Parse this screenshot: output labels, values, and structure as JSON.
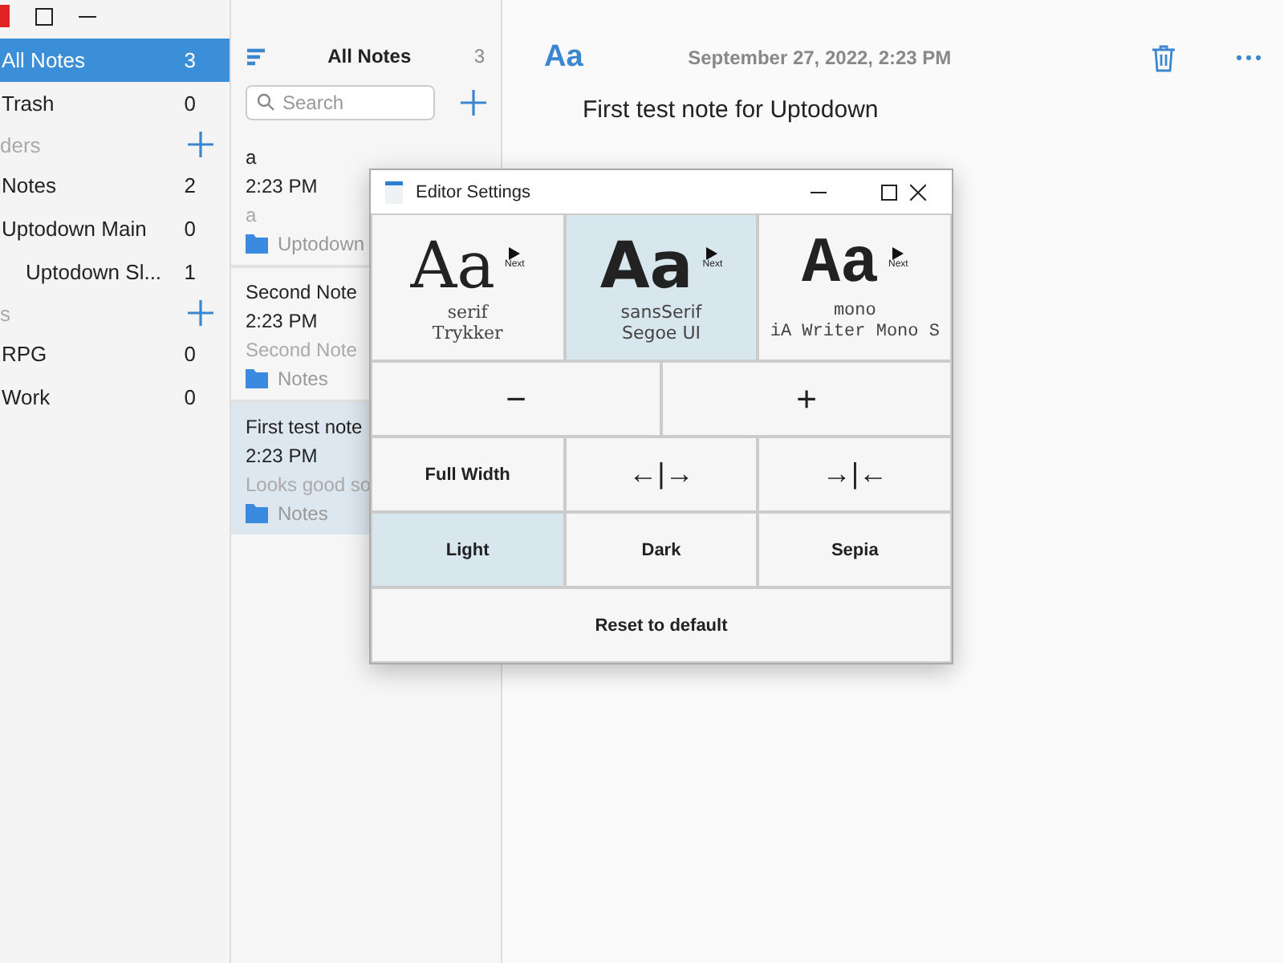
{
  "sidebar": {
    "items": [
      {
        "label": "All Notes",
        "count": "3",
        "selected": true
      },
      {
        "label": "Trash",
        "count": "0",
        "selected": false
      }
    ],
    "sections": [
      {
        "title": "ders",
        "items": [
          {
            "label": "Notes",
            "count": "2",
            "selected": false
          },
          {
            "label": "Uptodown Main",
            "count": "0",
            "selected": false,
            "children": [
              {
                "label": "Uptodown Sl...",
                "count": "1",
                "selected": false
              }
            ]
          }
        ]
      },
      {
        "title": "s",
        "items": [
          {
            "label": "RPG",
            "count": "0",
            "selected": false
          },
          {
            "label": "Work",
            "count": "0",
            "selected": false
          }
        ]
      }
    ]
  },
  "note_list": {
    "title": "All Notes",
    "count": "3",
    "search": {
      "placeholder": "Search"
    },
    "notes": [
      {
        "title": "a",
        "time": "2:23 PM",
        "preview": "a",
        "folder": "Uptodown",
        "selected": false
      },
      {
        "title": "Second Note",
        "time": "2:23 PM",
        "preview": "Second Note",
        "folder": "Notes",
        "selected": false
      },
      {
        "title": "First test note",
        "time": "2:23 PM",
        "preview": "Looks good so",
        "folder": "Notes",
        "selected": true
      }
    ]
  },
  "editor": {
    "font_button": "Aa",
    "date": "September 27, 2022, 2:23 PM",
    "text": "First test note for Uptodown"
  },
  "dialog": {
    "title": "Editor Settings",
    "fonts": [
      {
        "kind": "serif",
        "sample": "Aa",
        "next": "Next",
        "name": "serif",
        "family": "Trykker",
        "selected": false
      },
      {
        "kind": "sans",
        "sample": "Aa",
        "next": "Next",
        "name": "sansSerif",
        "family": "Segoe UI",
        "selected": true
      },
      {
        "kind": "mono",
        "sample": "Aa",
        "next": "Next",
        "name": "mono",
        "family": "iA Writer Mono S",
        "selected": false
      }
    ],
    "size_buttons": [
      "−",
      "+"
    ],
    "width_buttons": [
      {
        "label": "Full Width",
        "kind": "text"
      },
      {
        "label": "←|→",
        "kind": "symbol"
      },
      {
        "label": "→|←",
        "kind": "symbol"
      }
    ],
    "themes": [
      {
        "label": "Light",
        "selected": true
      },
      {
        "label": "Dark",
        "selected": false
      },
      {
        "label": "Sepia",
        "selected": false
      }
    ],
    "reset": "Reset to default"
  }
}
